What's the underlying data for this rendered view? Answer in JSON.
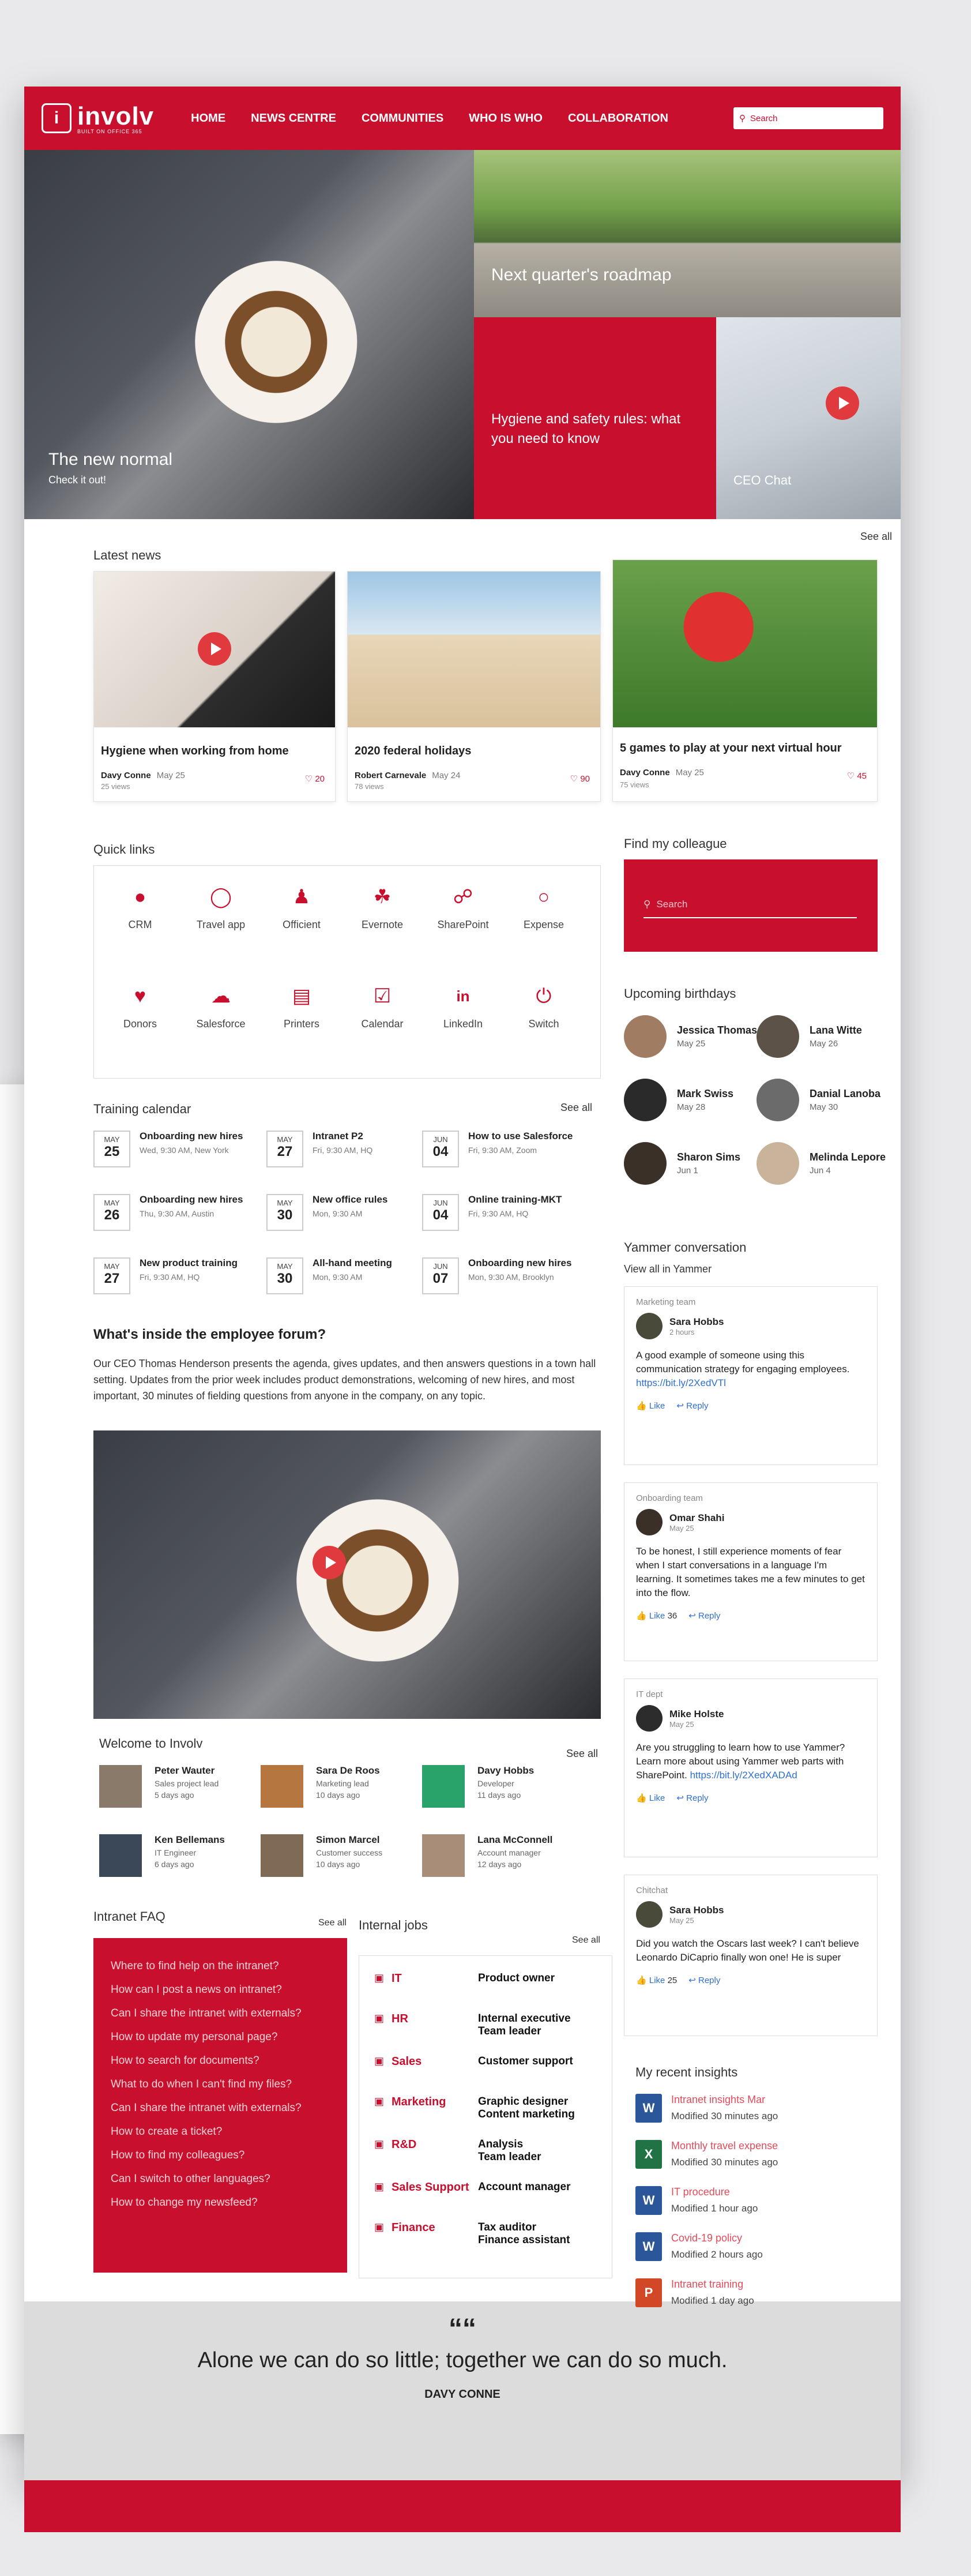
{
  "header": {
    "logo_text": "involv",
    "logo_sub": "BUILT ON OFFICE 365",
    "nav": [
      "HOME",
      "NEWS CENTRE",
      "COMMUNITIES",
      "WHO IS WHO",
      "COLLABORATION"
    ],
    "search_placeholder": "Search"
  },
  "hero": {
    "main_title": "The new normal",
    "main_sub": "Check it out!",
    "roadmap": "Next quarter's roadmap",
    "hygiene": "Hygiene and safety rules: what you need to know",
    "ceo": "CEO Chat",
    "see_all": "See all"
  },
  "latest_news": {
    "title": "Latest news",
    "cards": [
      {
        "title": "Hygiene when working from home",
        "author": "Davy Conne",
        "date": "May 25",
        "views": "25 views",
        "likes": "20"
      },
      {
        "title": "2020 federal holidays",
        "author": "Robert Carnevale",
        "date": "May 24",
        "views": "78 views",
        "likes": "90"
      },
      {
        "title": "5 games to play at your next virtual hour",
        "author": "Davy Conne",
        "date": "May 25",
        "views": "75 views",
        "likes": "45"
      }
    ]
  },
  "quick_links": {
    "title": "Quick links",
    "items": [
      "CRM",
      "Travel app",
      "Officient",
      "Evernote",
      "SharePoint",
      "Expense",
      "Donors",
      "Salesforce",
      "Printers",
      "Calendar",
      "LinkedIn",
      "Switch"
    ]
  },
  "colleague": {
    "title": "Find my colleague",
    "placeholder": "Search"
  },
  "birthdays": {
    "title": "Upcoming birthdays",
    "people": [
      {
        "name": "Jessica Thomas",
        "date": "May 25"
      },
      {
        "name": "Lana Witte",
        "date": "May 26"
      },
      {
        "name": "Mark Swiss",
        "date": "May 28"
      },
      {
        "name": "Danial Lanoba",
        "date": "May 30"
      },
      {
        "name": "Sharon Sims",
        "date": "Jun 1"
      },
      {
        "name": "Melinda Lepore",
        "date": "Jun 4"
      }
    ]
  },
  "training": {
    "title": "Training calendar",
    "see_all": "See all",
    "events": [
      {
        "m": "MAY",
        "d": "25",
        "t": "Onboarding new hires",
        "s": "Wed, 9:30 AM, New York"
      },
      {
        "m": "MAY",
        "d": "27",
        "t": "Intranet P2",
        "s": "Fri, 9:30 AM, HQ"
      },
      {
        "m": "JUN",
        "d": "04",
        "t": "How to use Salesforce",
        "s": "Fri, 9:30 AM, Zoom"
      },
      {
        "m": "MAY",
        "d": "26",
        "t": "Onboarding new hires",
        "s": "Thu, 9:30 AM, Austin"
      },
      {
        "m": "MAY",
        "d": "30",
        "t": "New office rules",
        "s": "Mon, 9:30 AM"
      },
      {
        "m": "JUN",
        "d": "04",
        "t": "Online training-MKT",
        "s": "Fri, 9:30 AM, HQ"
      },
      {
        "m": "MAY",
        "d": "27",
        "t": "New product training",
        "s": "Fri, 9:30 AM, HQ"
      },
      {
        "m": "MAY",
        "d": "30",
        "t": "All-hand meeting",
        "s": "Mon, 9:30 AM"
      },
      {
        "m": "JUN",
        "d": "07",
        "t": "Onboarding new hires",
        "s": "Mon, 9:30 AM, Brooklyn"
      }
    ]
  },
  "forum": {
    "title": "What's inside the employee forum?",
    "body": "Our CEO Thomas Henderson presents the agenda, gives updates, and then answers questions in a town hall setting. Updates from the prior week includes product demonstrations, welcoming of new hires, and most important, 30 minutes of fielding questions from anyone in the company, on any topic."
  },
  "yammer": {
    "title": "Yammer conversation",
    "view_all": "View all in Yammer",
    "posts": [
      {
        "team": "Marketing team",
        "name": "Sara Hobbs",
        "time": "2 hours",
        "body": "A good example of someone using this communication strategy for engaging employees.",
        "link": "https://bit.ly/2XedVTl",
        "like": "Like",
        "count": "",
        "reply": "Reply"
      },
      {
        "team": "Onboarding team",
        "name": "Omar Shahi",
        "time": "May 25",
        "body": "To be honest, I still experience moments of fear when I start conversations in a language I'm learning. It sometimes takes me a few minutes to get into the flow.",
        "link": "",
        "like": "Like",
        "count": "36",
        "reply": "Reply"
      },
      {
        "team": "IT dept",
        "name": "Mike Holste",
        "time": "May 25",
        "body": "Are you struggling to learn how to use Yammer? Learn more about using Yammer web parts with SharePoint.",
        "link": "https://bit.ly/2XedXADAd",
        "like": "Like",
        "count": "",
        "reply": "Reply"
      },
      {
        "team": "Chitchat",
        "name": "Sara Hobbs",
        "time": "May 25",
        "body": "Did you watch the Oscars last week? I can't believe Leonardo DiCaprio finally won one! He is super",
        "link": "",
        "like": "Like",
        "count": "25",
        "reply": "Reply"
      }
    ]
  },
  "welcome": {
    "title": "Welcome to Involv",
    "see_all": "See all",
    "people": [
      {
        "name": "Peter Wauter",
        "role": "Sales project lead",
        "ago": "5 days ago"
      },
      {
        "name": "Sara De Roos",
        "role": "Marketing lead",
        "ago": "10 days ago"
      },
      {
        "name": "Davy Hobbs",
        "role": "Developer",
        "ago": "11 days ago"
      },
      {
        "name": "Ken Bellemans",
        "role": "IT Engineer",
        "ago": "6 days ago"
      },
      {
        "name": "Simon Marcel",
        "role": "Customer success",
        "ago": "10 days ago"
      },
      {
        "name": "Lana McConnell",
        "role": "Account manager",
        "ago": "12 days ago"
      }
    ]
  },
  "faq": {
    "title": "Intranet FAQ",
    "see_all": "See all",
    "items": [
      "Where to find help on the intranet?",
      "How can I post a news on intranet?",
      "Can I share the intranet with externals?",
      "How to update my personal page?",
      "How to search for documents?",
      "What to do when I can't find my files?",
      "Can I share the intranet with externals?",
      "How to create a ticket?",
      "How to find my colleagues?",
      "Can I switch to other languages?",
      "How to change my newsfeed?"
    ]
  },
  "jobs": {
    "title": "Internal jobs",
    "see_all": "See all",
    "items": [
      {
        "dept": "IT",
        "title": "Product owner"
      },
      {
        "dept": "HR",
        "title": "Internal executive Team leader"
      },
      {
        "dept": "Sales",
        "title": "Customer support"
      },
      {
        "dept": "Marketing",
        "title": "Graphic designer Content marketing"
      },
      {
        "dept": "R&D",
        "title": "Analysis Team leader"
      },
      {
        "dept": "Sales Support",
        "title": "Account manager"
      },
      {
        "dept": "Finance",
        "title": "Tax auditor Finance assistant"
      }
    ]
  },
  "insights": {
    "title": "My recent insights",
    "items": [
      {
        "icon": "W",
        "color": "#2b579a",
        "name": "Intranet insights Mar",
        "mod": "Modified 30 minutes ago"
      },
      {
        "icon": "X",
        "color": "#217346",
        "name": "Monthly travel expense",
        "mod": "Modified 30 minutes ago"
      },
      {
        "icon": "W",
        "color": "#2b579a",
        "name": "IT procedure",
        "mod": "Modified 1 hour ago"
      },
      {
        "icon": "W",
        "color": "#2b579a",
        "name": "Covid-19 policy",
        "mod": "Modified 2 hours ago"
      },
      {
        "icon": "P",
        "color": "#d24726",
        "name": "Intranet training",
        "mod": "Modified 1 day ago"
      }
    ]
  },
  "quote": {
    "mark": "““",
    "text": "Alone we can do so little; together we can do so much.",
    "author": "DAVY CONNE"
  },
  "colors": {
    "brand": "#c8102e",
    "accent_link": "#2e6fd1"
  }
}
